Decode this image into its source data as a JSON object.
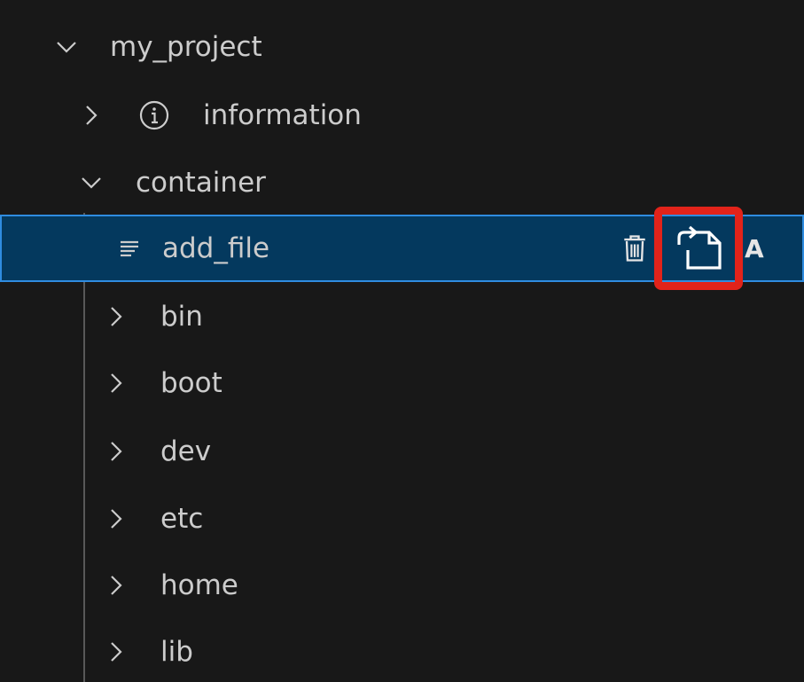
{
  "explorer": {
    "root": {
      "label": "my_project",
      "expanded": true,
      "icon": "chevron-down-icon"
    },
    "information": {
      "label": "information",
      "icon": "info-circle-icon",
      "expanded": false
    },
    "container": {
      "label": "container",
      "expanded": true
    },
    "selected_file": {
      "label": "add_file",
      "icon": "file-lines-icon",
      "actions": {
        "delete_icon": "trash-icon",
        "copy_icon": "file-transfer-icon"
      },
      "decoration": "A"
    },
    "folders": [
      {
        "label": "bin"
      },
      {
        "label": "boot"
      },
      {
        "label": "dev"
      },
      {
        "label": "etc"
      },
      {
        "label": "home"
      },
      {
        "label": "lib"
      }
    ]
  },
  "colors": {
    "background": "#181818",
    "selection_bg": "#04395e",
    "selection_border": "#2f8ce0",
    "highlight_red": "#e2231a",
    "text": "#cccccc"
  }
}
